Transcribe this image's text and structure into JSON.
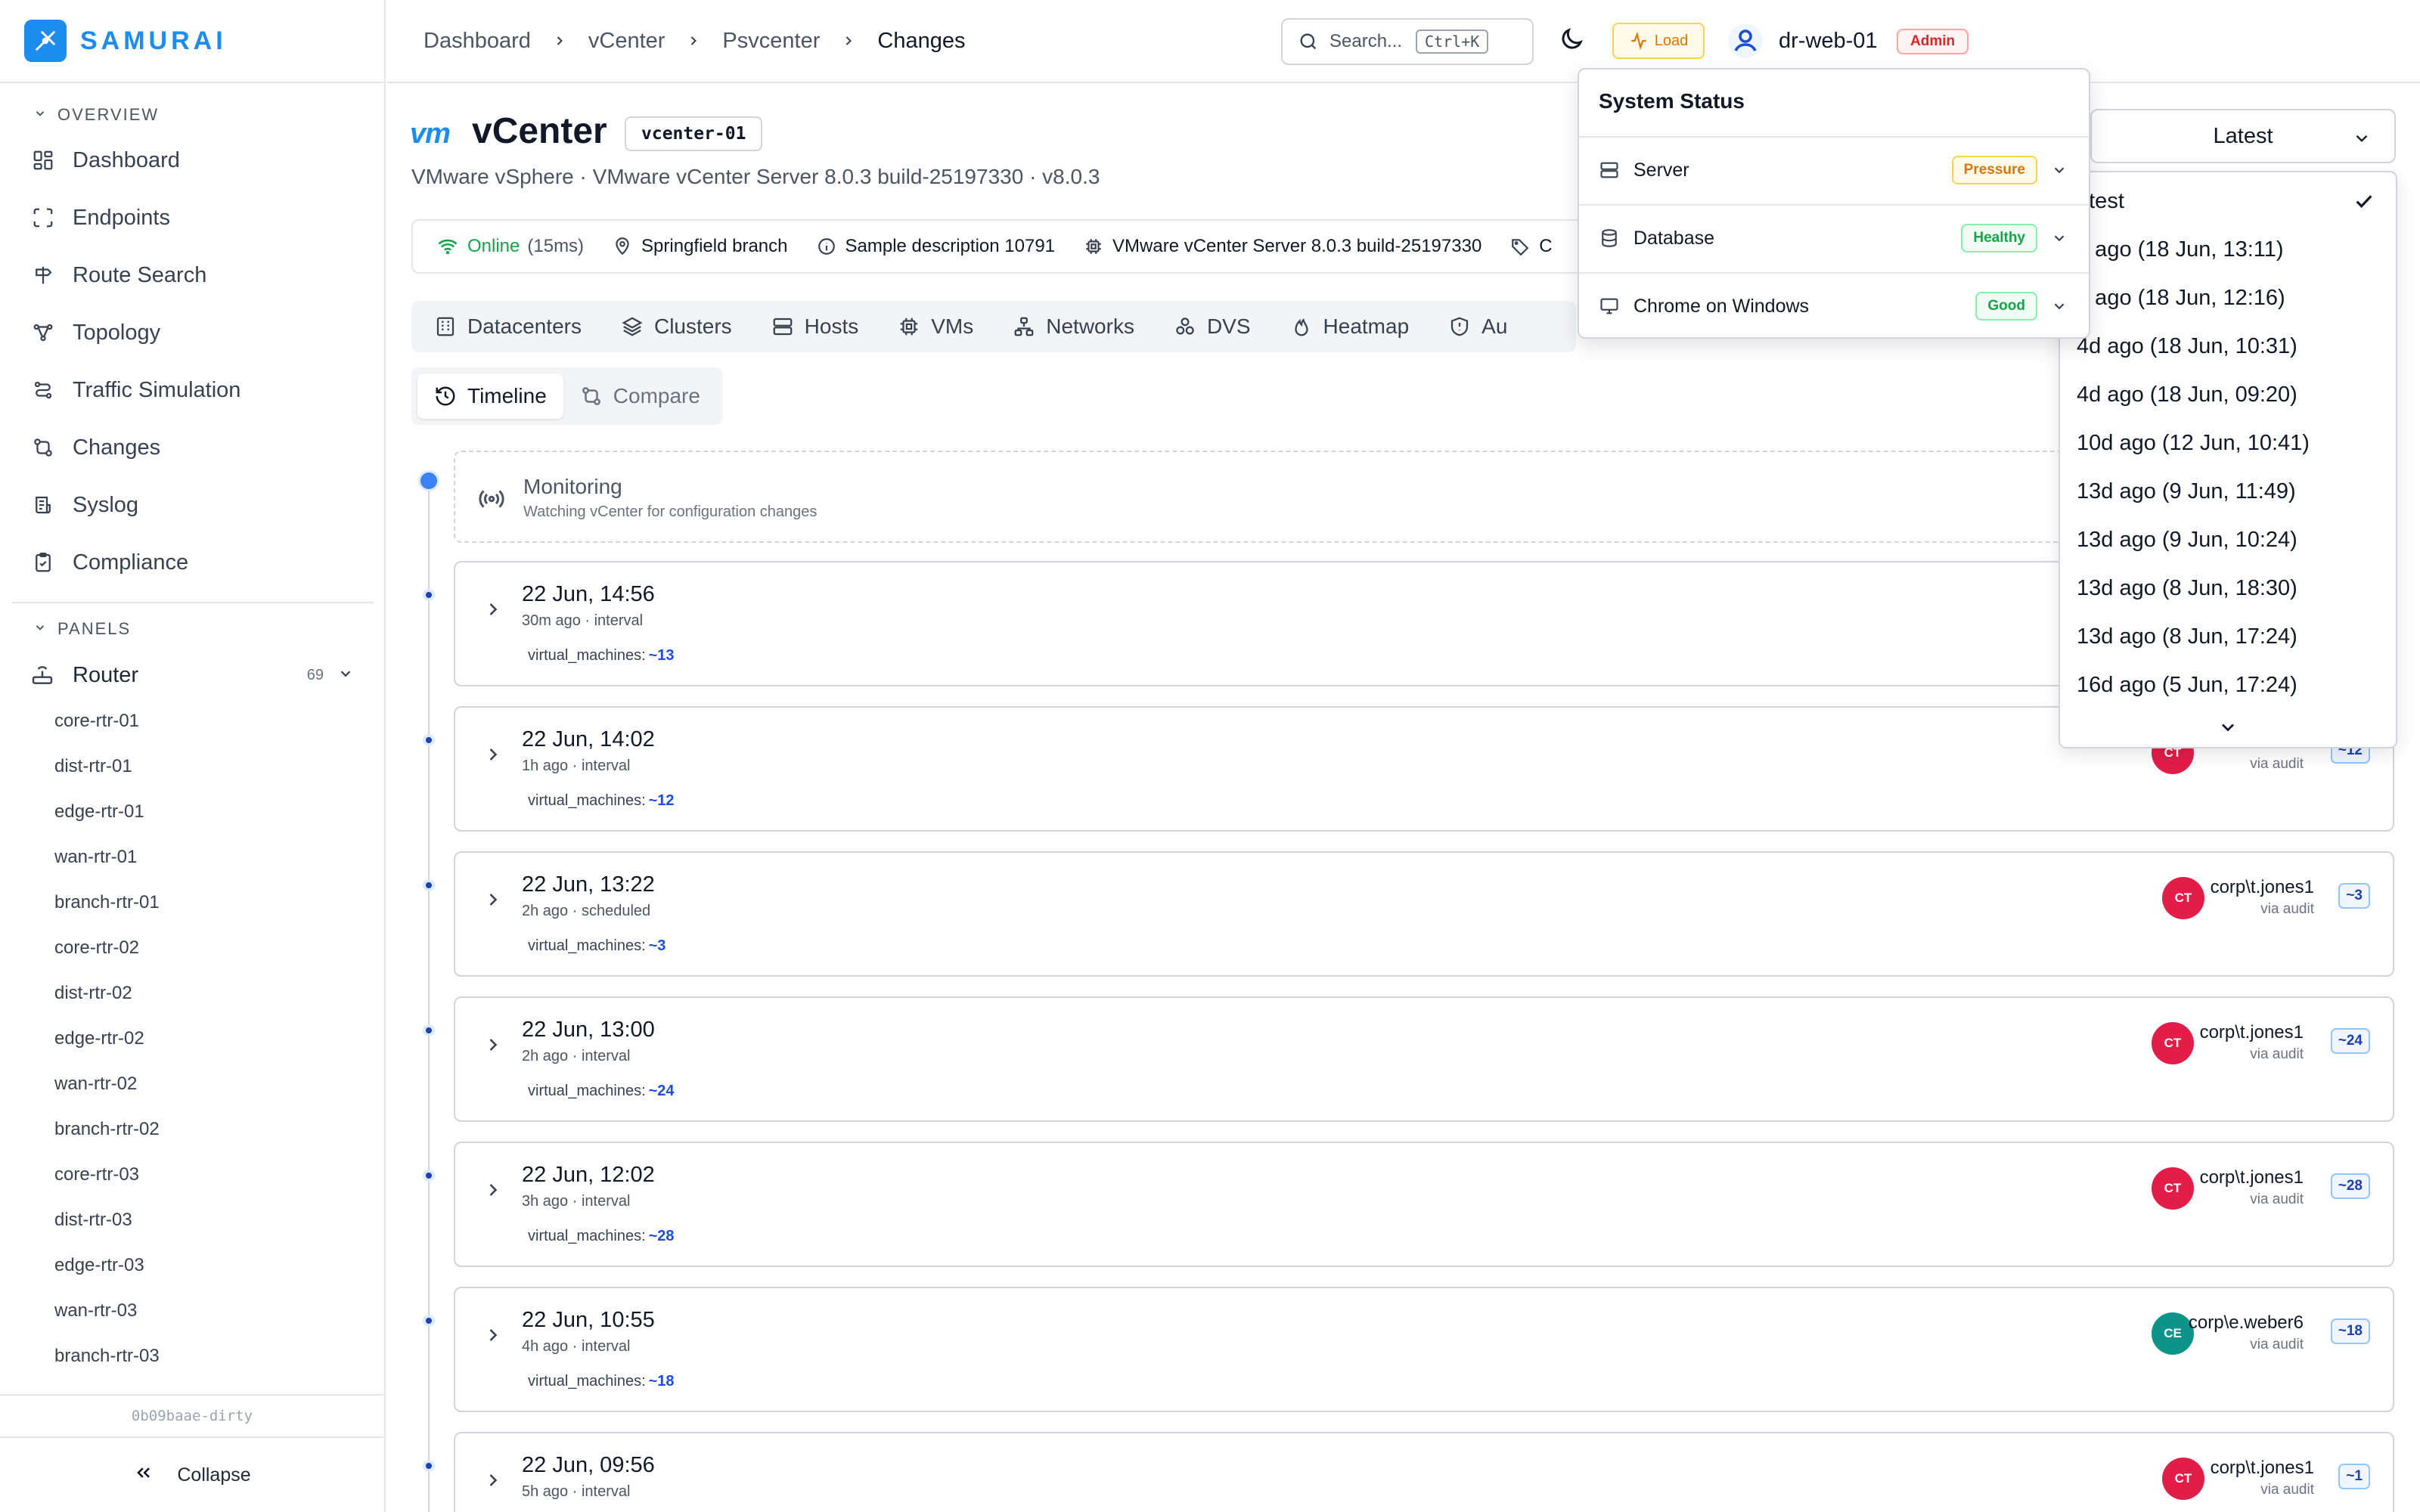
{
  "app": {
    "name": "SAMURAI"
  },
  "sidebar": {
    "overview_label": "OVERVIEW",
    "nav": [
      {
        "label": "Dashboard",
        "icon": "dashboard-icon"
      },
      {
        "label": "Endpoints",
        "icon": "endpoints-icon"
      },
      {
        "label": "Route Search",
        "icon": "signpost-icon"
      },
      {
        "label": "Topology",
        "icon": "topology-icon"
      },
      {
        "label": "Traffic Simulation",
        "icon": "traffic-icon"
      },
      {
        "label": "Changes",
        "icon": "changes-icon"
      },
      {
        "label": "Syslog",
        "icon": "syslog-icon"
      },
      {
        "label": "Compliance",
        "icon": "clipboard-check-icon"
      }
    ],
    "panels_label": "PANELS",
    "panel": {
      "label": "Router",
      "count": "69"
    },
    "routers": [
      "core-rtr-01",
      "dist-rtr-01",
      "edge-rtr-01",
      "wan-rtr-01",
      "branch-rtr-01",
      "core-rtr-02",
      "dist-rtr-02",
      "edge-rtr-02",
      "wan-rtr-02",
      "branch-rtr-02",
      "core-rtr-03",
      "dist-rtr-03",
      "edge-rtr-03",
      "wan-rtr-03",
      "branch-rtr-03"
    ],
    "version": "0b09baae-dirty",
    "collapse_label": "Collapse"
  },
  "topbar": {
    "breadcrumbs": [
      "Dashboard",
      "vCenter",
      "Psvcenter",
      "Changes"
    ],
    "search_placeholder": "Search...",
    "search_shortcut": "Ctrl+K",
    "load_label": "Load",
    "user": "dr-web-01",
    "role": "Admin"
  },
  "header": {
    "vendor_logo": "vm",
    "title": "vCenter",
    "id": "vcenter-01",
    "subtitle": "VMware vSphere · VMware vCenter Server 8.0.3 build-25197330 · v8.0.3",
    "status": "Online",
    "latency": "(15ms)",
    "location": "Springfield branch",
    "description": "Sample description 10791",
    "product": "VMware vCenter Server 8.0.3 build-25197330",
    "tag_partial": "C"
  },
  "tabs": [
    {
      "label": "Datacenters"
    },
    {
      "label": "Clusters"
    },
    {
      "label": "Hosts"
    },
    {
      "label": "VMs"
    },
    {
      "label": "Networks"
    },
    {
      "label": "DVS"
    },
    {
      "label": "Heatmap"
    },
    {
      "label": "Au"
    }
  ],
  "subtabs": [
    {
      "label": "Timeline"
    },
    {
      "label": "Compare"
    }
  ],
  "monitoring": {
    "title": "Monitoring",
    "subtitle": "Watching vCenter for configuration changes"
  },
  "entries": [
    {
      "time": "22 Jun, 14:56",
      "meta": "30m ago · interval",
      "field": "virtual_machines:",
      "value": "~13",
      "author": "",
      "via": "",
      "initials": "",
      "delta": ""
    },
    {
      "time": "22 Jun, 14:02",
      "meta": "1h ago · interval",
      "field": "virtual_machines:",
      "value": "~12",
      "author": "",
      "via": "via audit",
      "initials": "CT",
      "delta": "~12"
    },
    {
      "time": "22 Jun, 13:22",
      "meta": "2h ago · scheduled",
      "field": "virtual_machines:",
      "value": "~3",
      "author": "corp\\t.jones1",
      "via": "via audit",
      "initials": "CT",
      "delta": "~3"
    },
    {
      "time": "22 Jun, 13:00",
      "meta": "2h ago · interval",
      "field": "virtual_machines:",
      "value": "~24",
      "author": "corp\\t.jones1",
      "via": "via audit",
      "initials": "CT",
      "delta": "~24"
    },
    {
      "time": "22 Jun, 12:02",
      "meta": "3h ago · interval",
      "field": "virtual_machines:",
      "value": "~28",
      "author": "corp\\t.jones1",
      "via": "via audit",
      "initials": "CT",
      "delta": "~28"
    },
    {
      "time": "22 Jun, 10:55",
      "meta": "4h ago · interval",
      "field": "virtual_machines:",
      "value": "~18",
      "author": "corp\\e.weber6",
      "via": "via audit",
      "initials": "CE",
      "delta": "~18"
    },
    {
      "time": "22 Jun, 09:56",
      "meta": "5h ago · interval",
      "field": "",
      "value": "",
      "author": "corp\\t.jones1",
      "via": "via audit",
      "initials": "CT",
      "delta": "~1"
    }
  ],
  "version_select": {
    "selected": "Latest",
    "options": [
      "atest",
      "d ago (18 Jun, 13:11)",
      "d ago (18 Jun, 12:16)",
      "4d ago (18 Jun, 10:31)",
      "4d ago (18 Jun, 09:20)",
      "10d ago (12 Jun, 10:41)",
      "13d ago (9 Jun, 11:49)",
      "13d ago (9 Jun, 10:24)",
      "13d ago (8 Jun, 18:30)",
      "13d ago (8 Jun, 17:24)",
      "16d ago (5 Jun, 17:24)"
    ]
  },
  "system_status": {
    "title": "System Status",
    "rows": [
      {
        "label": "Server",
        "status": "Pressure",
        "color": "#d97706"
      },
      {
        "label": "Database",
        "status": "Healthy",
        "color": "#16a34a"
      },
      {
        "label": "Chrome on Windows",
        "status": "Good",
        "color": "#16a34a"
      }
    ]
  },
  "colors": {
    "accent": "#1d8cf0",
    "crimson": "#e11d48",
    "teal": "#0d9488",
    "admin": "#dc2626"
  }
}
